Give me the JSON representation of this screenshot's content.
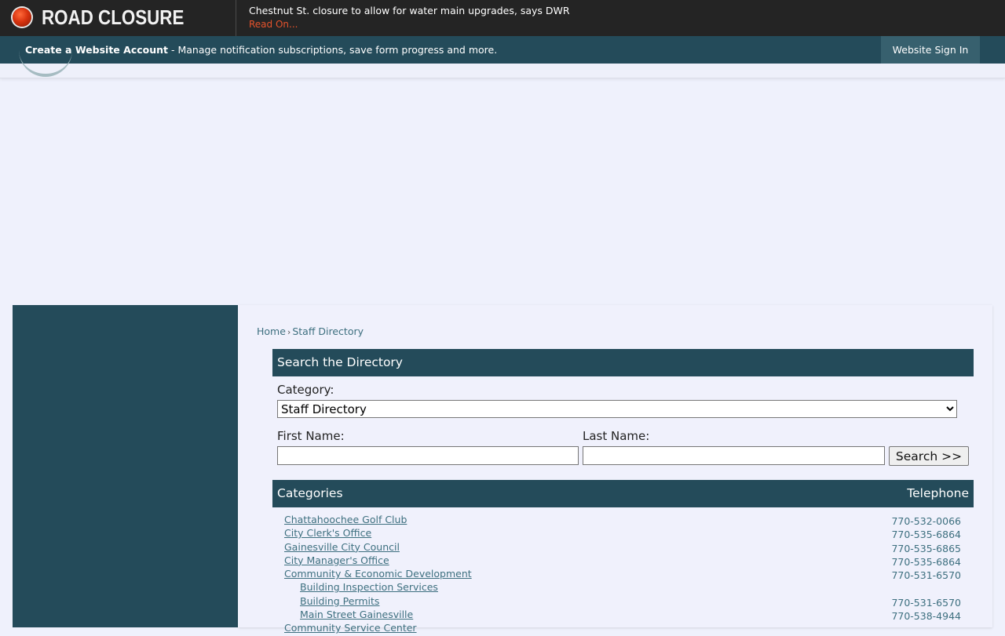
{
  "alert": {
    "title": "ROAD CLOSURE",
    "message": "Chestnut St. closure to allow for water main upgrades, says DWR",
    "link": "Read On..."
  },
  "account_bar": {
    "create_label": "Create a Website Account",
    "description": " - Manage notification subscriptions, save form progress and more.",
    "sign_in": "Website Sign In"
  },
  "breadcrumb": {
    "home": "Home",
    "separator": "›",
    "current": "Staff Directory"
  },
  "search": {
    "heading": "Search the Directory",
    "category_label": "Category:",
    "category_selected": "Staff Directory",
    "first_name_label": "First Name:",
    "last_name_label": "Last Name:",
    "first_name_value": "",
    "last_name_value": "",
    "button": "Search >>"
  },
  "categories": {
    "heading": "Categories",
    "telephone_heading": "Telephone",
    "rows": [
      {
        "name": "Chattahoochee Golf Club",
        "phone": "770-532-0066",
        "indent": 0
      },
      {
        "name": "City Clerk's Office",
        "phone": "770-535-6864",
        "indent": 0
      },
      {
        "name": "Gainesville City Council",
        "phone": "770-535-6865",
        "indent": 0
      },
      {
        "name": "City Manager's Office",
        "phone": "770-535-6864",
        "indent": 0
      },
      {
        "name": "Community & Economic Development",
        "phone": "770-531-6570",
        "indent": 0
      },
      {
        "name": "Building Inspection Services",
        "phone": "",
        "indent": 1
      },
      {
        "name": "Building Permits",
        "phone": "770-531-6570",
        "indent": 1
      },
      {
        "name": "Main Street Gainesville",
        "phone": "770-538-4944",
        "indent": 1
      },
      {
        "name": "Community Service Center",
        "phone": "",
        "indent": 0
      }
    ]
  },
  "colors": {
    "alert_bg": "#242424",
    "brand_teal": "#244b5a",
    "link": "#3d6f7f",
    "alert_link": "#e5532c",
    "page_bg": "#eff1fc"
  }
}
